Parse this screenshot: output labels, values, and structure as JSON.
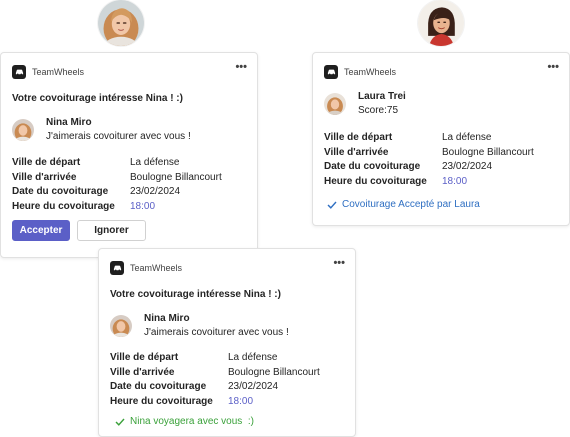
{
  "app": {
    "name": "TeamWheels"
  },
  "card_request": {
    "headline": "Votre covoiturage intéresse Nina ! :)",
    "sender_name": "Nina Miro",
    "sender_message": "J'aimerais covoiturer avec vous !",
    "facts": [
      {
        "label": "Ville de départ",
        "value": "La défense"
      },
      {
        "label": "Ville d'arrivée",
        "value": "Boulogne Billancourt"
      },
      {
        "label": "Date du covoiturage",
        "value": "23/02/2024"
      },
      {
        "label": "Heure du covoiturage",
        "value": "18:00"
      }
    ],
    "accept_label": "Accepter",
    "ignore_label": "Ignorer"
  },
  "card_accepted": {
    "person_name": "Laura Trei",
    "score": "Score:75",
    "facts": [
      {
        "label": "Ville de départ",
        "value": "La défense"
      },
      {
        "label": "Ville d'arrivée",
        "value": "Boulogne Billancourt"
      },
      {
        "label": "Date du covoiturage",
        "value": "23/02/2024"
      },
      {
        "label": "Heure du covoiturage",
        "value": "18:00"
      }
    ],
    "status": "Covoiturage Accepté par Laura",
    "status_color": "#2f6fc2"
  },
  "card_confirmed": {
    "headline": "Votre covoiturage intéresse Nina ! :)",
    "sender_name": "Nina Miro",
    "sender_message": "J'aimerais covoiturer avec vous !",
    "facts": [
      {
        "label": "Ville de départ",
        "value": "La défense"
      },
      {
        "label": "Ville d'arrivée",
        "value": "Boulogne Billancourt"
      },
      {
        "label": "Date du covoiturage",
        "value": "23/02/2024"
      },
      {
        "label": "Heure du covoiturage",
        "value": "18:00"
      }
    ],
    "status": "Nina voyagera avec vous  :)",
    "status_color": "#3aa13a"
  },
  "colors": {
    "accent": "#5b5fc7",
    "text": "#242424",
    "border": "#e1e1e1"
  },
  "icons": {
    "app": "car-icon",
    "more": "more-options-icon",
    "check": "check-icon"
  }
}
